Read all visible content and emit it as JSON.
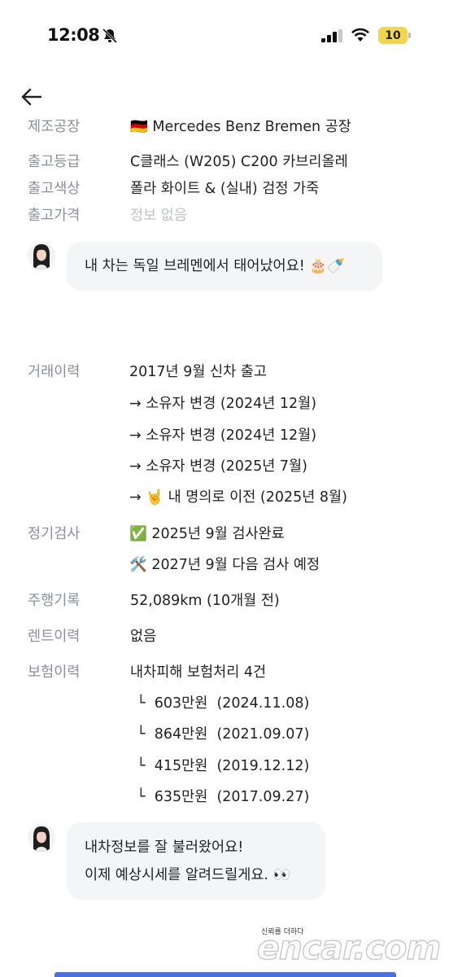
{
  "status": {
    "time": "12:08",
    "battery": "10"
  },
  "specs_top": [
    {
      "label": "제조공장",
      "value": "Mercedes Benz Bremen 공장",
      "flag": "🇩🇪"
    },
    {
      "label": "출고등급",
      "value": "C클래스 (W205) C200 카브리올레"
    },
    {
      "label": "출고색상",
      "value": "폴라 화이트 & (실내) 검정 가죽"
    },
    {
      "label": "출고가격",
      "value": "정보 없음"
    }
  ],
  "chat1": {
    "text": "내 차는 독일 브레멘에서 태어났어요! 🎂🍼"
  },
  "history": {
    "label": "거래이력",
    "lines": [
      "2017년 9월 신차 출고",
      "→ 소유자 변경 (2024년 12월)",
      "→ 소유자 변경 (2024년 12월)",
      "→ 소유자 변경 (2025년 7월)",
      "→ 🤘 내 명의로 이전 (2025년 8월)"
    ]
  },
  "inspection": {
    "label": "정기검사",
    "lines": [
      "✅ 2025년 9월 검사완료",
      "🛠️ 2027년 9월 다음 검사 예정"
    ]
  },
  "mileage": {
    "label": "주행기록",
    "value": "52,089km (10개월 전)"
  },
  "rental": {
    "label": "렌트이력",
    "value": "없음"
  },
  "insurance": {
    "label": "보험이력",
    "summary": "내차피해 보험처리 4건",
    "items": [
      {
        "prefix": "└",
        "amount": "603만원",
        "date": "(2024.11.08)"
      },
      {
        "prefix": "└",
        "amount": "864만원",
        "date": "(2021.09.07)"
      },
      {
        "prefix": "└",
        "amount": "415만원",
        "date": "(2019.12.12)"
      },
      {
        "prefix": "└",
        "amount": "635만원",
        "date": "(2017.09.27)"
      }
    ]
  },
  "chat2": {
    "line1": "내차정보를 잘 불러왔어요!",
    "line2": "이제 예상시세를 알려드릴게요. 👀"
  },
  "footer": {
    "tagline": "신뢰를 더하다",
    "logo": "encar.com"
  }
}
